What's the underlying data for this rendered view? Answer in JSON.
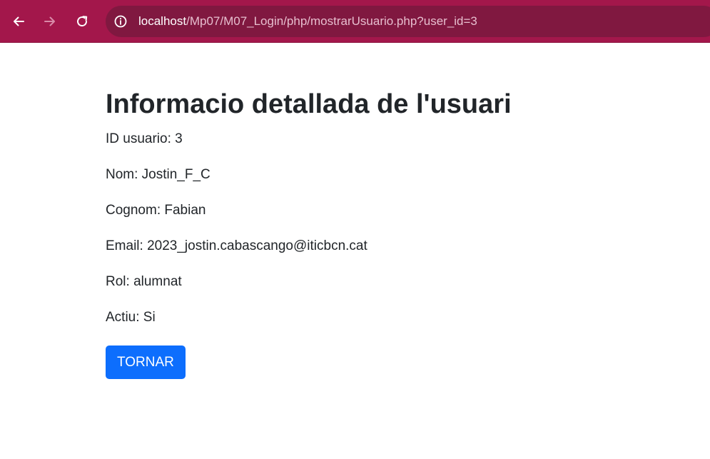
{
  "browser": {
    "url_host": "localhost",
    "url_path": "/Mp07/M07_Login/php/mostrarUsuario.php?user_id=3",
    "theme_color": "#a3174b",
    "omnibox_color": "#801840",
    "icons": {
      "back": "arrow-left-icon",
      "forward": "arrow-right-icon",
      "reload": "reload-icon",
      "site_info": "info-icon"
    }
  },
  "page": {
    "title": "Informacio detallada de l'usuari",
    "fields": [
      {
        "label": "ID usuario: 3"
      },
      {
        "label": "Nom: Jostin_F_C"
      },
      {
        "label": "Cognom: Fabian"
      },
      {
        "label": "Email: 2023_jostin.cabascango@iticbcn.cat"
      },
      {
        "label": "Rol: alumnat"
      },
      {
        "label": "Actiu: Si"
      }
    ],
    "back_button": "TORNAR",
    "button_color": "#0d6efd"
  }
}
